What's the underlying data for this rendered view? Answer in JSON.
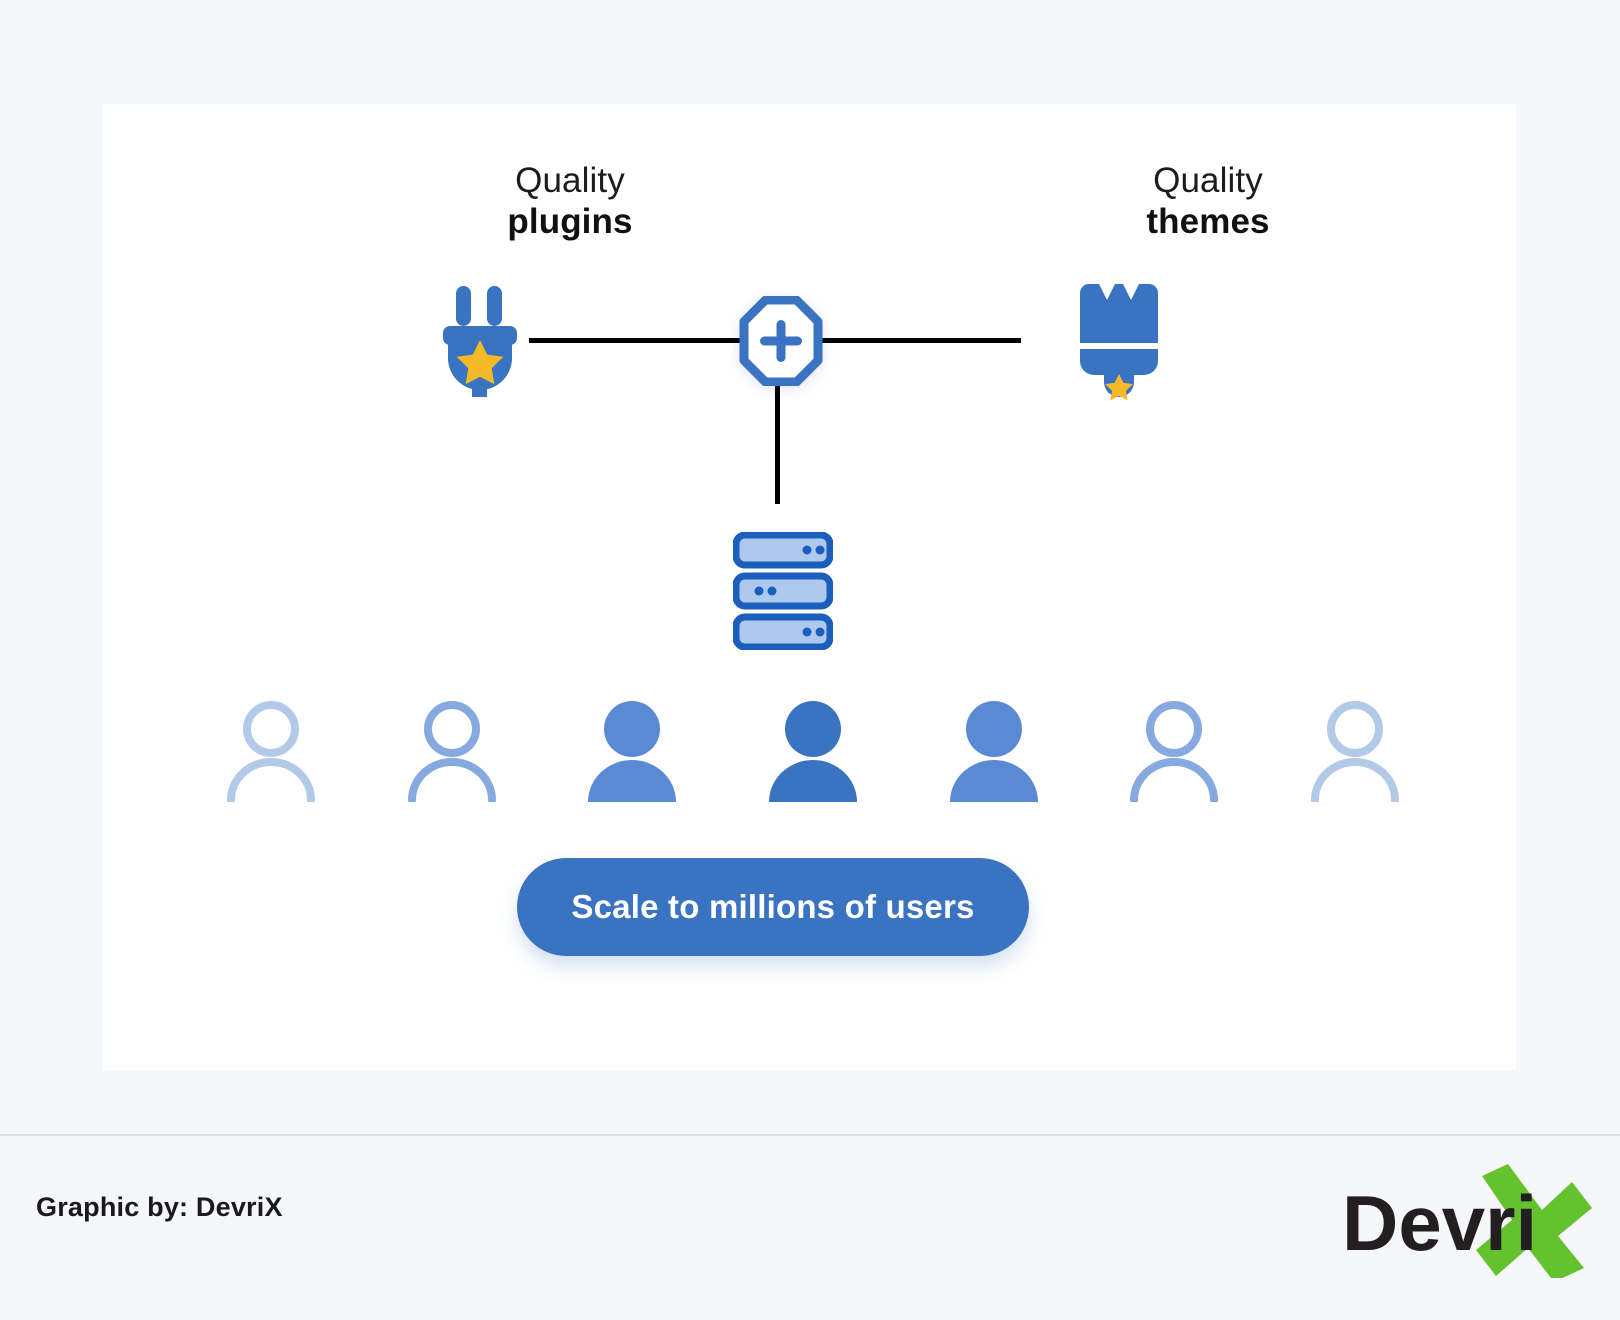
{
  "canvas": {
    "background": "#f5f7fb",
    "card_background": "#ffffff"
  },
  "colors": {
    "brand_blue": "#3a73c1",
    "deep_blue": "#1b5fbe",
    "light_blue_fill": "#aec8ee",
    "mid_blue": "#5b8ad4",
    "pale_blue": "#b3c9e8",
    "star_gold": "#f7b928",
    "line_black": "#000000",
    "logo_green": "#63c22e",
    "logo_dark": "#231f20"
  },
  "diagram": {
    "left_node": {
      "label_top": "Quality",
      "label_bottom": "plugins",
      "icon": "plug-icon"
    },
    "right_node": {
      "label_top": "Quality",
      "label_bottom": "themes",
      "icon": "paintbrush-icon"
    },
    "hub_node": {
      "icon": "plus-octagon-icon"
    },
    "server_node": {
      "icon": "server-stack-icon",
      "units": 3
    },
    "connectors": [
      "horizontal-left",
      "horizontal-right",
      "vertical-down"
    ],
    "people": [
      {
        "style": "outline",
        "tone": "pale"
      },
      {
        "style": "outline",
        "tone": "light"
      },
      {
        "style": "filled",
        "tone": "mid"
      },
      {
        "style": "filled",
        "tone": "deep"
      },
      {
        "style": "filled",
        "tone": "mid"
      },
      {
        "style": "outline",
        "tone": "light"
      },
      {
        "style": "outline",
        "tone": "pale"
      }
    ]
  },
  "cta": {
    "label": "Scale to millions of users"
  },
  "footer": {
    "credit": "Graphic by: DevriX",
    "logo": {
      "word": "Devri",
      "mark": "X"
    }
  }
}
